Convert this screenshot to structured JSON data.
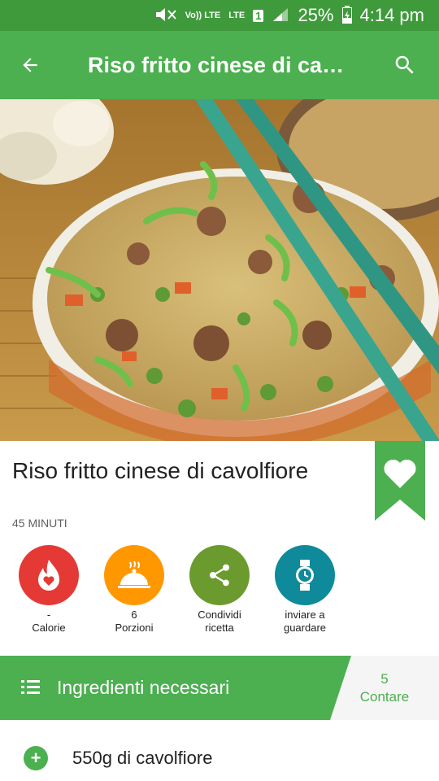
{
  "status_bar": {
    "volte": "Vo)) LTE",
    "lte": "LTE",
    "sim": "1",
    "battery": "25%",
    "time": "4:14 pm"
  },
  "app_bar": {
    "title": "Riso fritto cinese di cavolfiore",
    "back_icon": "arrow-back-icon",
    "search_icon": "search-icon"
  },
  "hero": {
    "description_icon": "food-photo"
  },
  "recipe": {
    "title": "Riso fritto cinese di cavolfiore",
    "duration": "45 MINUTI",
    "bookmark_icon": "heart-icon"
  },
  "actions": [
    {
      "value": "-",
      "label": "Calorie",
      "icon": "flame-heart-icon",
      "color": "#e53935"
    },
    {
      "value": "6",
      "label": "Porzioni",
      "icon": "serving-dish-icon",
      "color": "#ff9800"
    },
    {
      "value": "",
      "label": "Condividi ricetta",
      "icon": "share-icon",
      "color": "#6b9a2e"
    },
    {
      "value": "",
      "label": "inviare a guardare",
      "icon": "watch-icon",
      "color": "#0e8a9a"
    }
  ],
  "ingredients_header": {
    "title": "Ingredienti necessari",
    "count": "5",
    "count_label": "Contare"
  },
  "ingredients": [
    {
      "text": "550g di cavolfiore"
    }
  ],
  "colors": {
    "status_bar": "#3f9a3c",
    "primary": "#4caf50"
  }
}
